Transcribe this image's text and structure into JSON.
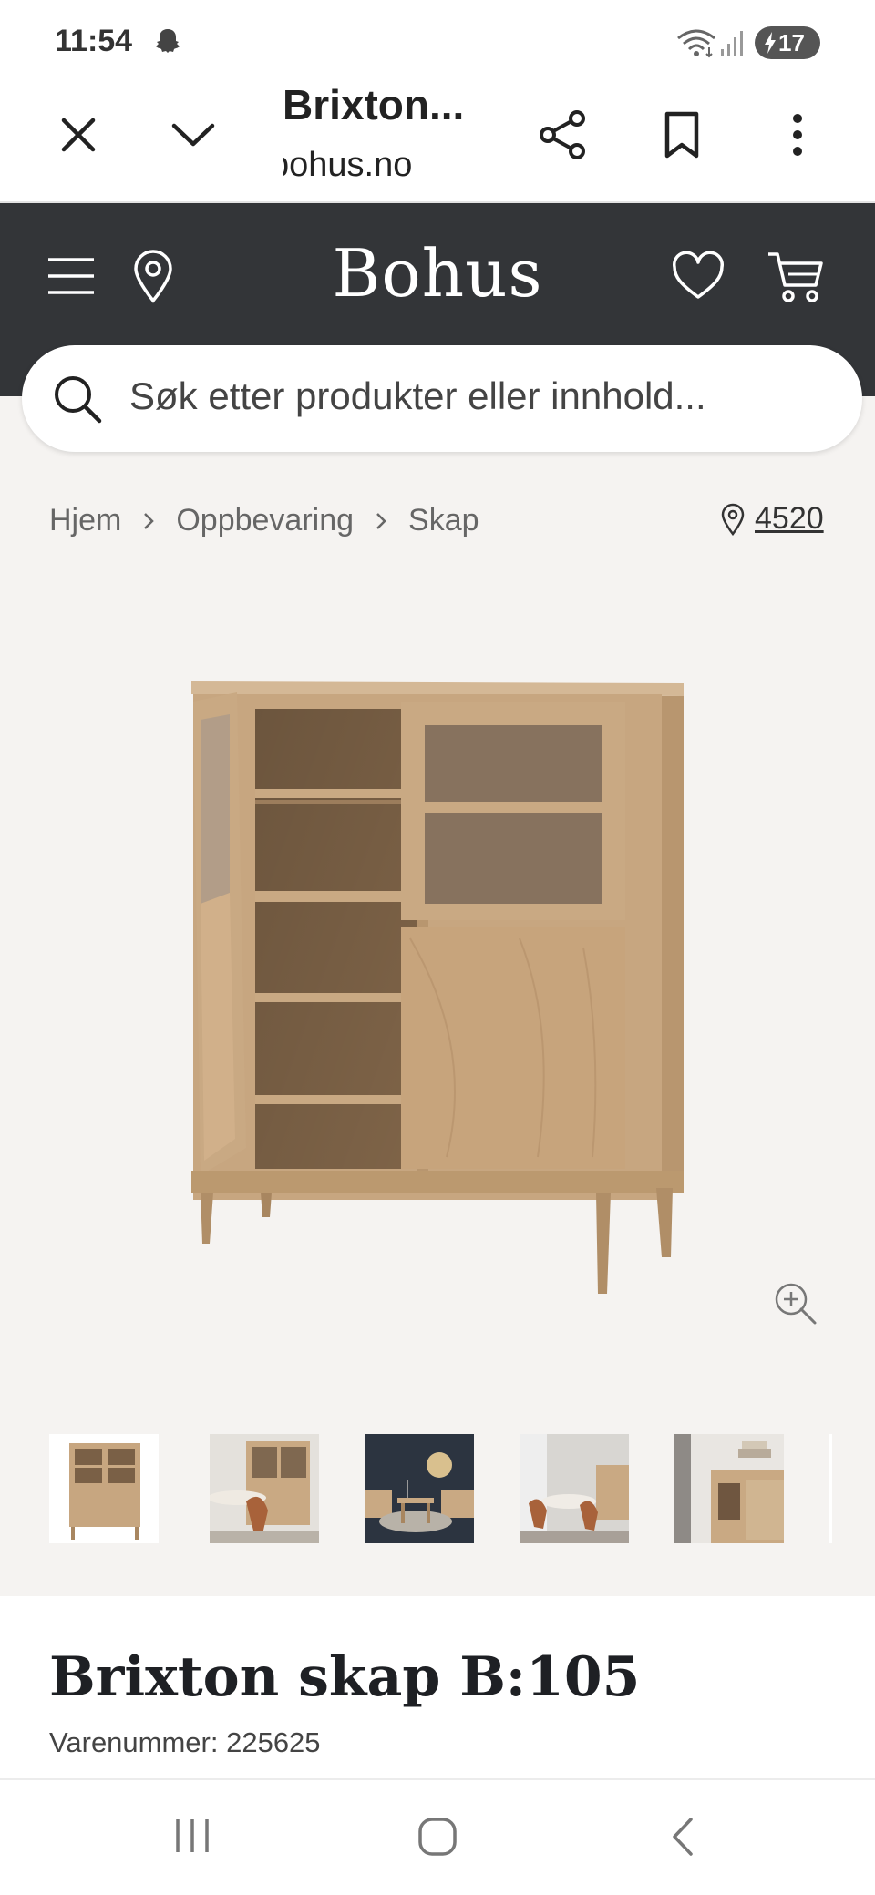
{
  "status_bar": {
    "time": "11:54",
    "battery": "17"
  },
  "browser": {
    "title": "Brixton...",
    "url": "bohus.no"
  },
  "site": {
    "logo": "Bohus",
    "search_placeholder": "Søk etter produkter eller innhold..."
  },
  "breadcrumb": {
    "items": [
      "Hjem",
      "Oppbevaring",
      "Skap"
    ],
    "store": "4520"
  },
  "product": {
    "title": "Brixton skap B:105",
    "sku": "Varenummer: 225625"
  },
  "colors": {
    "header_bg": "#333538",
    "page_bg": "#f5f3f1",
    "wood": "#c9a983"
  },
  "icons": [
    "close-icon",
    "chevron-down-icon",
    "share-icon",
    "bookmark-icon",
    "more-vertical-icon",
    "menu-icon",
    "location-icon",
    "heart-icon",
    "cart-icon",
    "search-icon",
    "zoom-in-icon",
    "recent-apps-icon",
    "home-icon",
    "back-icon"
  ]
}
